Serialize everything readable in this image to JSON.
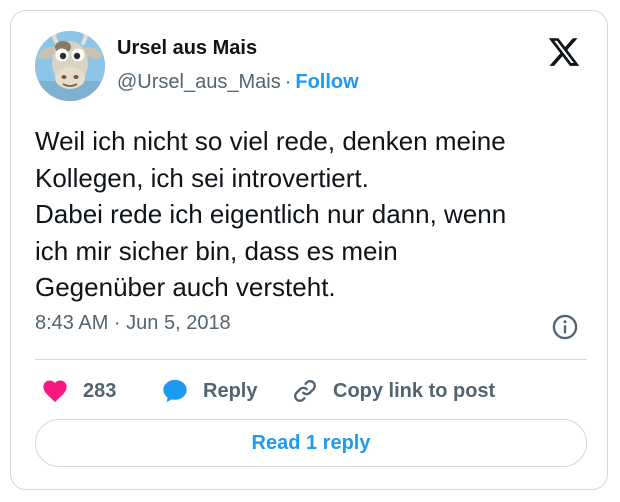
{
  "author": {
    "name": "Ursel aus Mais",
    "handle": "@Ursel_aus_Mais",
    "separator": "·",
    "follow_label": "Follow"
  },
  "tweet": {
    "text": "Weil ich nicht so viel rede, denken meine\nKollegen, ich sei introvertiert.\nDabei rede ich eigentlich nur dann, wenn\nich mir sicher bin, dass es mein\nGegenüber auch versteht.",
    "timestamp": "8:43 AM · Jun 5, 2018"
  },
  "actions": {
    "like_count": "283",
    "reply_label": "Reply",
    "copy_label": "Copy link to post"
  },
  "read_replies_label": "Read 1 reply",
  "icons": {
    "brand": "x-logo-icon",
    "like": "heart-icon",
    "reply": "speech-bubble-icon",
    "copy": "link-icon",
    "info": "info-icon"
  },
  "colors": {
    "accent": "#1d9bf0",
    "like": "#f91880",
    "text": "#0f1419",
    "secondary": "#536471",
    "border": "#cfd9de"
  }
}
